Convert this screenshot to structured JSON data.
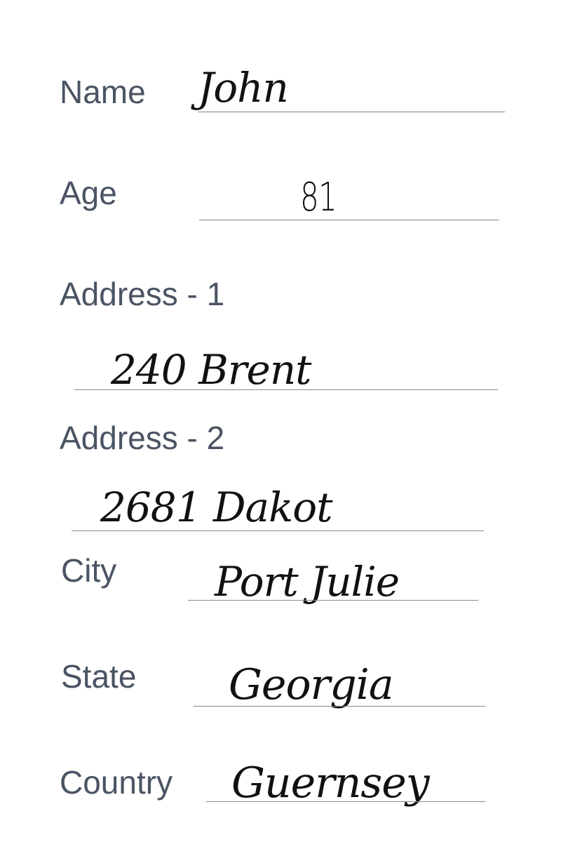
{
  "form": {
    "name": {
      "label": "Name",
      "value": "John"
    },
    "age": {
      "label": "Age",
      "value": "81"
    },
    "address1": {
      "label": "Address - 1",
      "value": "240 Brent"
    },
    "address2": {
      "label": "Address - 2",
      "value": "2681 Dakot"
    },
    "city": {
      "label": "City",
      "value": "Port Julie"
    },
    "state": {
      "label": "State",
      "value": "Georgia"
    },
    "country": {
      "label": "Country",
      "value": "Guernsey"
    }
  }
}
